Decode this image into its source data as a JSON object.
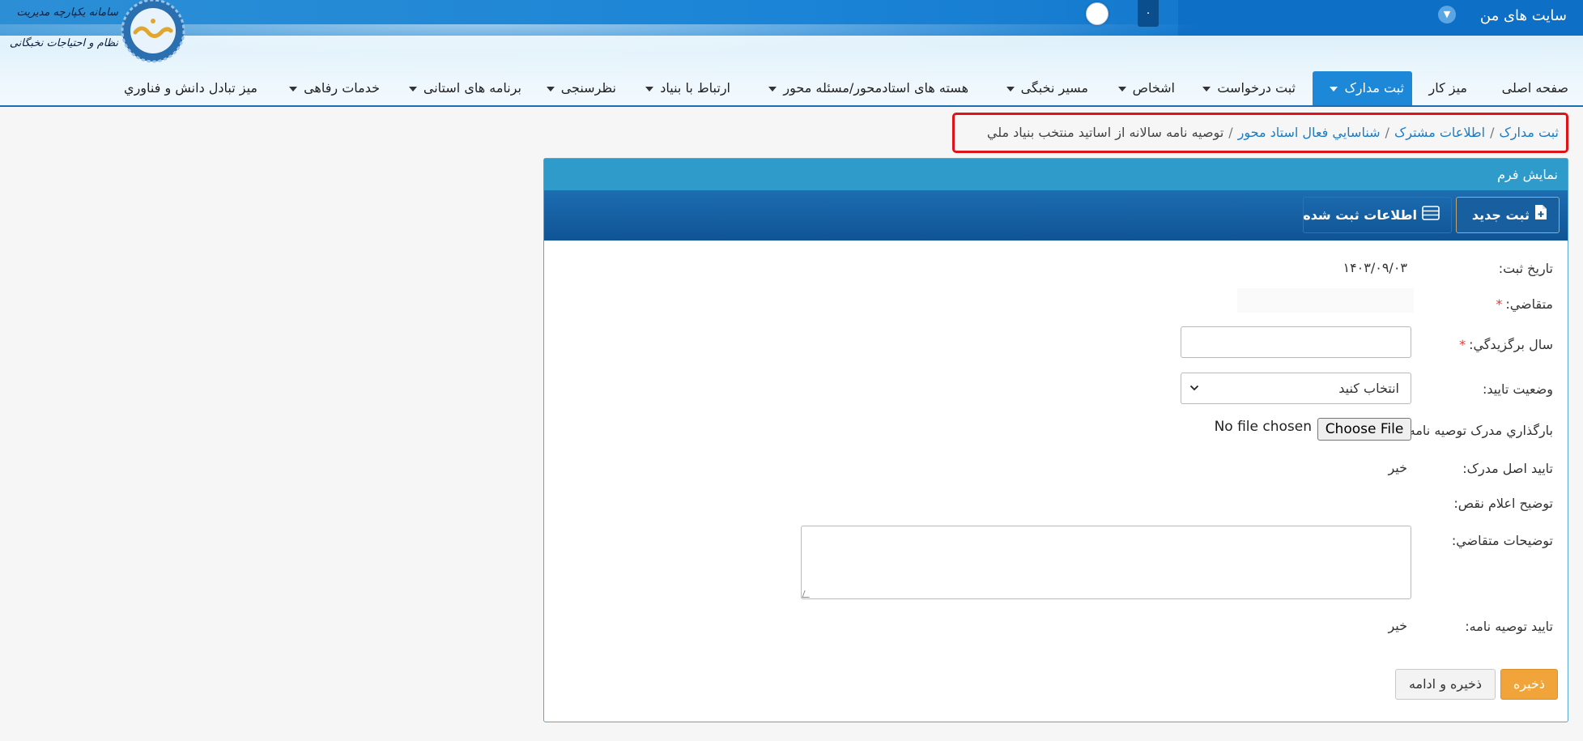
{
  "header": {
    "sites_label": "سایت های من",
    "counter": "۰",
    "logo_line1": "سامانه یکپارچه مدیریت",
    "logo_line2": "نظام و احتیاجات نخبگانی",
    "logo_icon": "sina-logo-icon"
  },
  "nav": {
    "items": [
      {
        "label": "صفحه اصلی",
        "dropdown": false
      },
      {
        "label": "میز کار",
        "dropdown": false
      },
      {
        "label": "ثبت مدارک",
        "dropdown": true,
        "active": true
      },
      {
        "label": "ثبت درخواست",
        "dropdown": true
      },
      {
        "label": "اشخاص",
        "dropdown": true
      },
      {
        "label": "مسیر نخبگی",
        "dropdown": true
      },
      {
        "label": "هسته های استادمحور/مسئله محور",
        "dropdown": true
      },
      {
        "label": "ارتباط با بنیاد",
        "dropdown": true
      },
      {
        "label": "نظرسنجی",
        "dropdown": true
      },
      {
        "label": "برنامه های استانی",
        "dropdown": true
      },
      {
        "label": "خدمات رفاهی",
        "dropdown": true
      },
      {
        "label": "میز تبادل دانش و فناوري",
        "dropdown": false
      }
    ]
  },
  "breadcrumb": {
    "items": [
      "ثبت مدارک",
      "اطلاعات مشترک",
      "شناسايي فعال استاد محور"
    ],
    "current": "توصيه نامه سالانه از اساتيد منتخب بنياد ملي",
    "separator": "/"
  },
  "panel": {
    "title": "نمایش فرم",
    "new_button": "ثبت جديد",
    "list_button": "اطلاعات ثبت شده"
  },
  "form": {
    "reg_date_label": "تاريخ ثبت:",
    "reg_date_value": "۱۴۰۳/۰۹/۰۳",
    "applicant_label": "متقاضي:",
    "year_label": "سال برگزيدگي:",
    "year_value": "",
    "status_label": "وضعيت تاييد:",
    "status_value": "انتخاب کنيد",
    "upload_label": "بارگذاري مدرک توصيه نامه:",
    "choose_file": "Choose File",
    "no_file": "No file chosen",
    "original_confirm_label": "تاييد اصل مدرک:",
    "original_confirm_value": "خير",
    "defect_label": "توضيح اعلام نقص:",
    "applicant_notes_label": "توضيحات متقاضي:",
    "recommend_confirm_label": "تاييد توصيه نامه:",
    "recommend_confirm_value": "خير",
    "required_mark": "*",
    "save_button": "ذخيره",
    "save_continue_button": "ذخيره و ادامه"
  },
  "colors": {
    "topbar": "#1b84d6",
    "nav_active": "#1e88d8",
    "panel_title": "#2e9bca",
    "toolbar": "#1d6db2",
    "breadcrumb_highlight": "#e0131b",
    "save": "#f0a43a"
  }
}
